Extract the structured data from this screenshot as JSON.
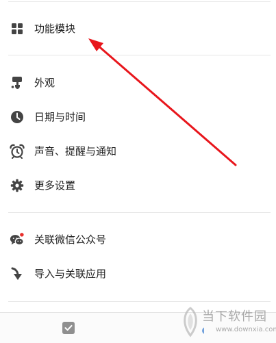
{
  "menu": {
    "group1": [
      {
        "label": "功能模块",
        "icon": "grid-icon"
      }
    ],
    "group2": [
      {
        "label": "外观",
        "icon": "paint-brush-icon"
      },
      {
        "label": "日期与时间",
        "icon": "clock-icon"
      },
      {
        "label": "声音、提醒与通知",
        "icon": "alarm-clock-icon"
      },
      {
        "label": "更多设置",
        "icon": "gear-icon"
      }
    ],
    "group3": [
      {
        "label": "关联微信公众号",
        "icon": "wechat-icon"
      },
      {
        "label": "导入与关联应用",
        "icon": "import-arrow-icon"
      }
    ]
  },
  "colors": {
    "icon": "#444444",
    "annotation_arrow": "#e8161c",
    "notification_dot": "#e8302c",
    "bottom_bar_icon": "#8f8f8f",
    "watermark_accent": "#3d7fd1"
  },
  "bottom_bar": {
    "icon": "checkbox-icon"
  },
  "watermark": {
    "title": "当下软件园",
    "url": "www.downxia.com",
    "icon": "leaf-logo-icon"
  }
}
